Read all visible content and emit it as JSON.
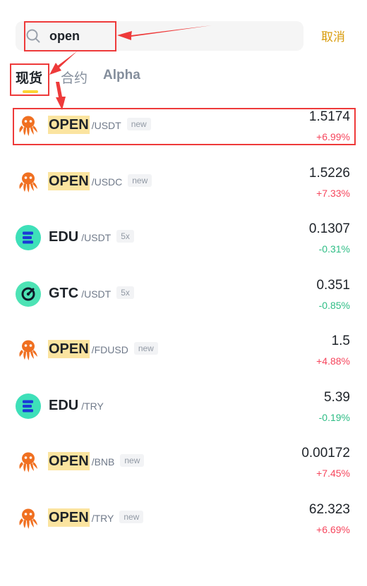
{
  "search": {
    "value": "open",
    "cancel_label": "取消"
  },
  "tabs": [
    {
      "label": "现货",
      "active": true
    },
    {
      "label": "合约",
      "active": false
    },
    {
      "label": "Alpha",
      "active": false
    }
  ],
  "colors": {
    "accent": "#d89b0a",
    "up": "#f6465d",
    "down": "#2ebd85",
    "highlight": "#fbe4a0",
    "annotation": "#ee3a3a"
  },
  "results": [
    {
      "icon": "octopus-icon",
      "base": "OPEN",
      "highlight": true,
      "quote": "/USDT",
      "tag": "new",
      "price": "1.5174",
      "change": "+6.99%",
      "direction": "up"
    },
    {
      "icon": "octopus-icon",
      "base": "OPEN",
      "highlight": true,
      "quote": "/USDC",
      "tag": "new",
      "price": "1.5226",
      "change": "+7.33%",
      "direction": "up"
    },
    {
      "icon": "edu-icon",
      "base": "EDU",
      "highlight": false,
      "quote": "/USDT",
      "tag": "5x",
      "price": "0.1307",
      "change": "-0.31%",
      "direction": "down"
    },
    {
      "icon": "gtc-icon",
      "base": "GTC",
      "highlight": false,
      "quote": "/USDT",
      "tag": "5x",
      "price": "0.351",
      "change": "-0.85%",
      "direction": "down"
    },
    {
      "icon": "octopus-icon",
      "base": "OPEN",
      "highlight": true,
      "quote": "/FDUSD",
      "tag": "new",
      "price": "1.5",
      "change": "+4.88%",
      "direction": "up"
    },
    {
      "icon": "edu-icon",
      "base": "EDU",
      "highlight": false,
      "quote": "/TRY",
      "tag": "",
      "price": "5.39",
      "change": "-0.19%",
      "direction": "down"
    },
    {
      "icon": "octopus-icon",
      "base": "OPEN",
      "highlight": true,
      "quote": "/BNB",
      "tag": "new",
      "price": "0.00172",
      "change": "+7.45%",
      "direction": "up"
    },
    {
      "icon": "octopus-icon",
      "base": "OPEN",
      "highlight": true,
      "quote": "/TRY",
      "tag": "new",
      "price": "62.323",
      "change": "+6.69%",
      "direction": "up"
    }
  ]
}
